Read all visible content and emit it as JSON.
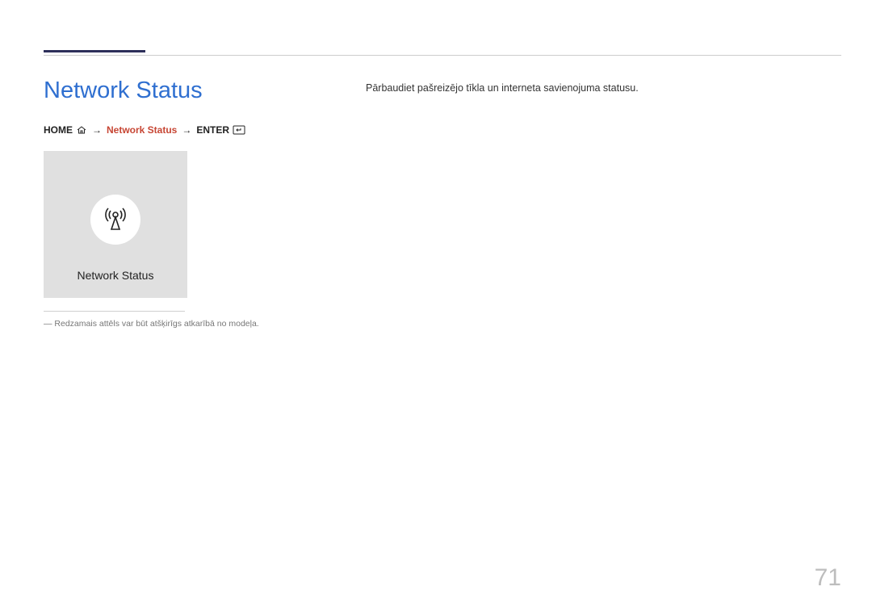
{
  "page": {
    "title": "Network Status",
    "description": "Pārbaudiet pašreizējo tīkla un interneta savienojuma statusu.",
    "number": "71"
  },
  "breadcrumb": {
    "home": "HOME",
    "item": "Network Status",
    "enter": "ENTER",
    "arrow": "→"
  },
  "tile": {
    "label": "Network Status"
  },
  "note": {
    "dash": "―",
    "text": "Redzamais attēls var būt atšķirīgs atkarībā no modeļa."
  }
}
